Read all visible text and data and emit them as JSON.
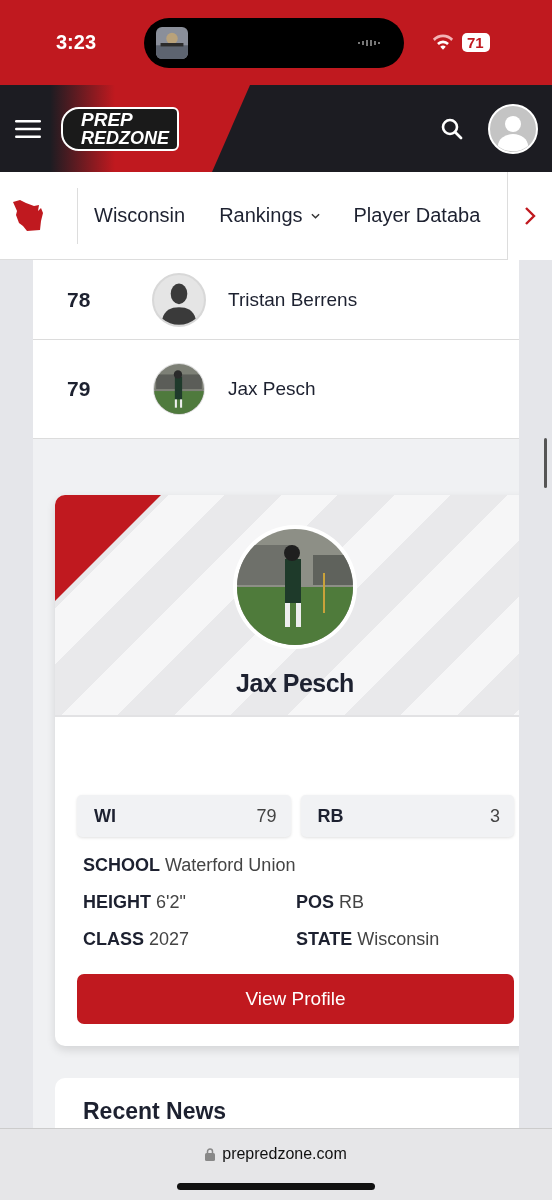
{
  "status_bar": {
    "time": "3:23",
    "battery": "71"
  },
  "header": {
    "logo_top": "PREP",
    "logo_bottom": "REDZONE"
  },
  "nav": {
    "items": [
      {
        "label": "Wisconsin",
        "kind": "link"
      },
      {
        "label": "Rankings",
        "kind": "dropdown"
      },
      {
        "label": "Player Databa",
        "kind": "link"
      }
    ]
  },
  "rankings": [
    {
      "rank": "78",
      "name": "Tristan Berrens",
      "kind": "silhouette"
    },
    {
      "rank": "79",
      "name": "Jax Pesch",
      "kind": "picture"
    }
  ],
  "player_card": {
    "name": "Jax Pesch",
    "chips": [
      {
        "label": "WI",
        "value": "79"
      },
      {
        "label": "RB",
        "value": "3"
      }
    ],
    "details": [
      [
        {
          "label": "SCHOOL",
          "value": "Waterford Union"
        }
      ],
      [
        {
          "label": "HEIGHT",
          "value": "6'2\""
        },
        {
          "label": "POS",
          "value": "RB"
        }
      ],
      [
        {
          "label": "CLASS",
          "value": "2027"
        },
        {
          "label": "STATE",
          "value": "Wisconsin"
        }
      ]
    ],
    "button": "View Profile"
  },
  "news": {
    "title": "Recent News"
  },
  "browser": {
    "url": "prepredzone.com"
  }
}
